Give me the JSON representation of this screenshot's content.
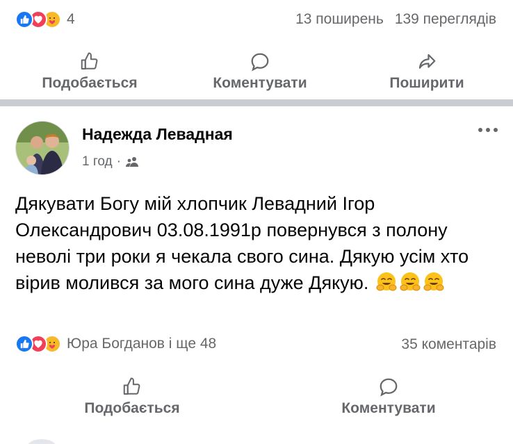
{
  "top_post": {
    "reactions": [
      "like-icon",
      "love-icon",
      "care-icon"
    ],
    "reaction_count": "4",
    "shares": "13 поширень",
    "views": "139 переглядів",
    "actions": {
      "like": "Подобається",
      "comment": "Коментувати",
      "share": "Поширити"
    }
  },
  "post": {
    "author": "Надежда Левадная",
    "time": "1 год",
    "time_separator": "·",
    "audience_icon": "friends-icon",
    "text": "Дякувати Богу мій хлопчик Левадний Ігор Олександрович 03.08.1991р повернувся з полону неволі три роки я чекала свого сина. Дякую усім хто вірив молився за мого сина дуже Дякую.",
    "text_emojis": [
      "hugging-face-emoji",
      "hugging-face-emoji",
      "hugging-face-emoji"
    ],
    "reactions": [
      "like-icon",
      "love-icon",
      "care-icon"
    ],
    "reaction_summary": "Юра Богданов і ще 48",
    "comments": "35 коментарів",
    "actions": {
      "like": "Подобається",
      "comment": "Коментувати"
    }
  },
  "colors": {
    "like": "#1877f2",
    "love": "#f33e58",
    "care": "#f7b928",
    "secondary_text": "#65676b",
    "separator": "#c9ccd1"
  }
}
